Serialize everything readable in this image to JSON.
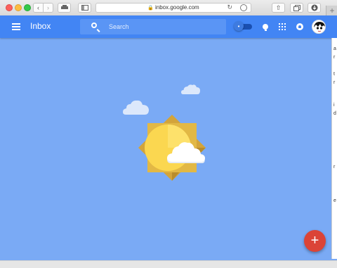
{
  "browser": {
    "url": "inbox.google.com"
  },
  "app": {
    "title": "Inbox"
  },
  "search": {
    "placeholder": "Search"
  },
  "fab": {
    "label": "+"
  },
  "colors": {
    "appbar": "#4285f4",
    "background": "#7aaaf5",
    "fab": "#db4437",
    "sun": "#fbd750"
  },
  "icons": [
    "menu-icon",
    "search-icon",
    "pin-icon",
    "reminder-bulb-icon",
    "apps-grid-icon",
    "notifications-icon",
    "avatar",
    "sun-icon",
    "cloud-icon",
    "plus-icon"
  ],
  "edge_text": [
    "a",
    "r",
    "t",
    "r",
    "i",
    "d",
    "r",
    "e"
  ]
}
